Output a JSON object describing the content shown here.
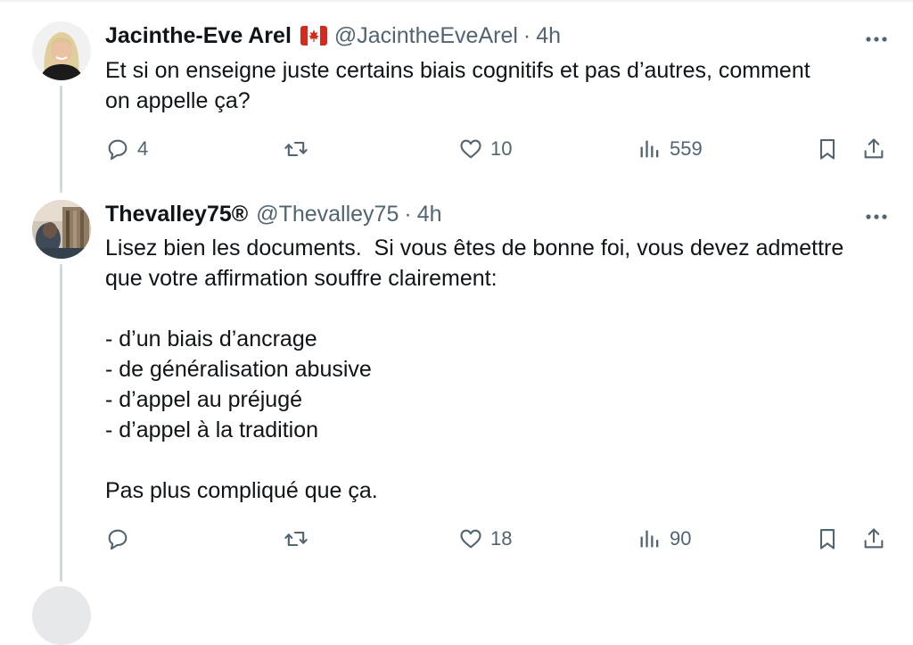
{
  "tweets": [
    {
      "author": {
        "name": "Jacinthe-Eve Arel",
        "handle": "@JacintheEveArel",
        "time": "4h",
        "flag": "canada-flag"
      },
      "text": "Et si on enseigne juste certains biais cognitifs et pas d’autres, comment\non appelle ça?",
      "actions": {
        "replies": "4",
        "retweets": "",
        "likes": "10",
        "views": "559"
      }
    },
    {
      "author": {
        "name": "Thevalley75®",
        "handle": "@Thevalley75",
        "time": "4h"
      },
      "text": "Lisez bien les documents.  Si vous êtes de bonne foi, vous devez admettre\nque votre affirmation souffre clairement:\n\n- d’un biais d’ancrage\n- de généralisation abusive\n- d’appel au préjugé\n- d’appel à la tradition\n\nPas plus compliqué que ça.",
      "actions": {
        "replies": "",
        "retweets": "",
        "likes": "18",
        "views": "90"
      }
    }
  ],
  "separator": "·",
  "colors": {
    "text": "#0f1419",
    "secondary": "#536471",
    "thread_line": "#cfd9de",
    "flag_red": "#d52b1e"
  }
}
